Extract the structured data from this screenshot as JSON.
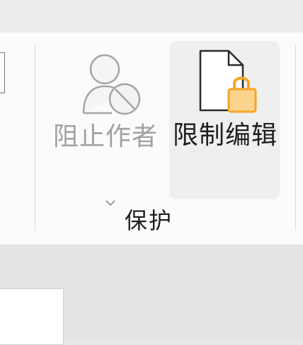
{
  "ribbon": {
    "group": {
      "label": "保护",
      "buttons": [
        {
          "label": "阻止作者",
          "icon": "block-user-icon",
          "state": "disabled",
          "has_dropdown": true
        },
        {
          "label": "限制编辑",
          "icon": "document-lock-icon",
          "state": "hover"
        }
      ]
    }
  },
  "colors": {
    "lock": "#f5a623",
    "lock_fill": "#fbd38d",
    "disabled_text": "#a1a1a1",
    "text": "#1e1e1e"
  }
}
